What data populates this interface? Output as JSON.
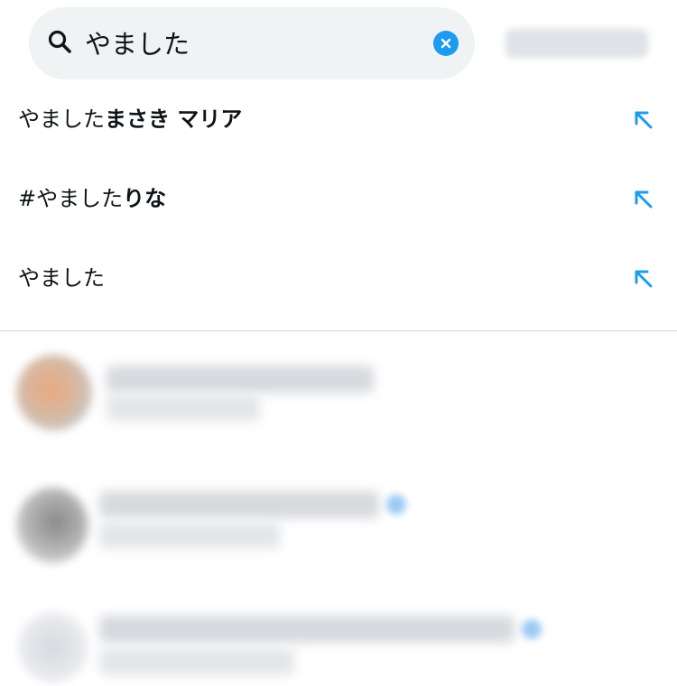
{
  "search": {
    "query": "やました",
    "placeholder": ""
  },
  "suggestions": [
    {
      "prefix": "やました",
      "suffix": "まさき マリア"
    },
    {
      "prefix": "#やました",
      "suffix": "りな"
    },
    {
      "prefix": "やました",
      "suffix": ""
    }
  ],
  "icons": {
    "search": "search-icon",
    "clear": "close-icon",
    "suggestion_arrow": "arrow-up-left-icon"
  },
  "colors": {
    "accent": "#1d9bf0",
    "search_bg": "#eff3f4",
    "text": "#0f1419",
    "divider": "#cfd9de"
  }
}
